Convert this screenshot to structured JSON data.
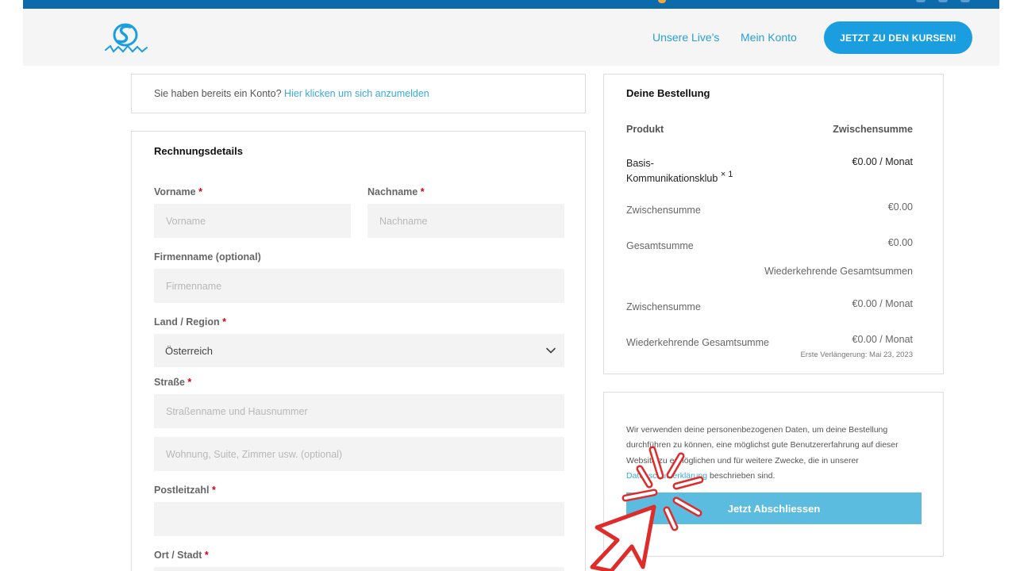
{
  "header": {
    "nav": [
      {
        "label": "Unsere Live's"
      },
      {
        "label": "Mein Konto"
      }
    ],
    "cta_label": "JETZT ZU DEN KURSEN!",
    "brand_color": "#1a9ee0",
    "logo_icon": "saletastic-logo-icon"
  },
  "login": {
    "prompt": "Sie haben bereits ein Konto?",
    "link": "Hier klicken um sich anzumelden"
  },
  "billing": {
    "title": "Rechnungsdetails",
    "vorname": {
      "label": "Vorname",
      "required": "*",
      "placeholder": "Vorname",
      "value": ""
    },
    "nachname": {
      "label": "Nachname",
      "required": "*",
      "placeholder": "Nachname",
      "value": ""
    },
    "firma": {
      "label": "Firmenname (optional)",
      "placeholder": "Firmenname",
      "value": ""
    },
    "land": {
      "label": "Land / Region",
      "required": "*",
      "value": "Österreich"
    },
    "strasse": {
      "label": "Straße",
      "required": "*",
      "placeholder": "Straßenname und Hausnummer",
      "placeholder2": "Wohnung, Suite, Zimmer usw. (optional)"
    },
    "plz": {
      "label": "Postleitzahl",
      "required": "*",
      "placeholder": ""
    },
    "ort": {
      "label": "Ort / Stadt",
      "required": "*"
    }
  },
  "order": {
    "title": "Deine Bestellung",
    "col_product": "Produkt",
    "col_subtotal": "Zwischensumme",
    "product_line1": "Basis-",
    "product_line2": "Kommunikationsklub",
    "product_qty": "× 1",
    "product_price": "€0.00 / Monat",
    "subtotal_label": "Zwischensumme",
    "subtotal_value": "€0.00",
    "total_label": "Gesamtsumme",
    "total_value": "€0.00",
    "recurring_heading": "Wiederkehrende Gesamtsummen",
    "rec_subtotal_label": "Zwischensumme",
    "rec_subtotal_value": "€0.00 / Monat",
    "rec_total_label": "Wiederkehrende Gesamtsumme",
    "rec_total_value": "€0.00 / Monat",
    "renewal": "Erste Verlängerung: Mai 23, 2023"
  },
  "privacy": {
    "text_before": "Wir verwenden deine personenbezogenen Daten, um deine Bestellung durchführen zu können, eine möglichst gute Benutzererfahrung auf dieser Website zu ermöglichen und für weitere Zwecke, die in unserer ",
    "link": "Datenschutzerklärung",
    "text_after": " beschrieben sind.",
    "submit_label": "Jetzt Abschliessen",
    "button_color": "#5bbcdf"
  },
  "annotation": {
    "icon": "click-cursor-icon",
    "color": "#e02b2b"
  }
}
